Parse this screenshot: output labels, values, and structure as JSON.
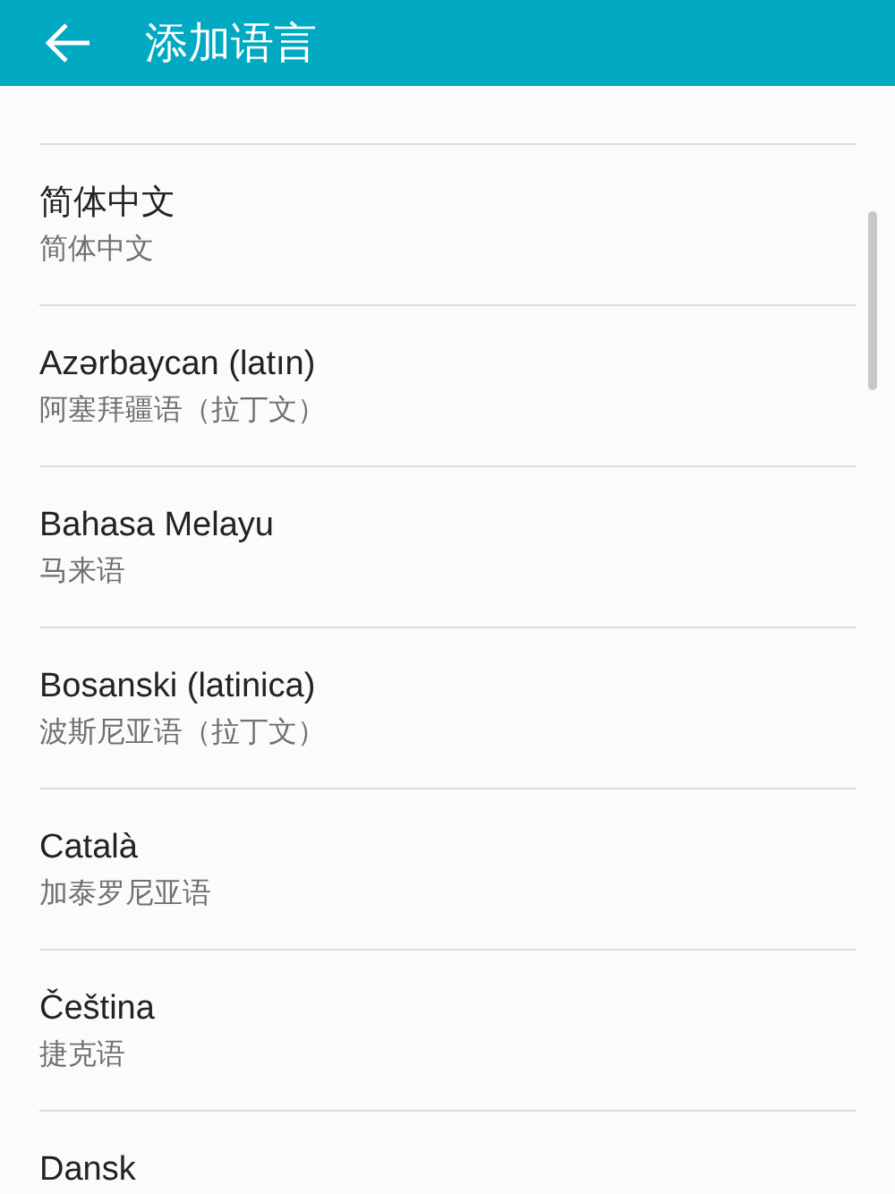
{
  "app_bar": {
    "title": "添加语言"
  },
  "languages": [
    {
      "title": "简体中文",
      "subtitle": "简体中文"
    },
    {
      "title": "Azərbaycan (latın)",
      "subtitle": "阿塞拜疆语（拉丁文）"
    },
    {
      "title": "Bahasa Melayu",
      "subtitle": "马来语"
    },
    {
      "title": "Bosanski (latinica)",
      "subtitle": "波斯尼亚语（拉丁文）"
    },
    {
      "title": "Català",
      "subtitle": "加泰罗尼亚语"
    },
    {
      "title": "Čeština",
      "subtitle": "捷克语"
    },
    {
      "title": "Dansk"
    }
  ]
}
